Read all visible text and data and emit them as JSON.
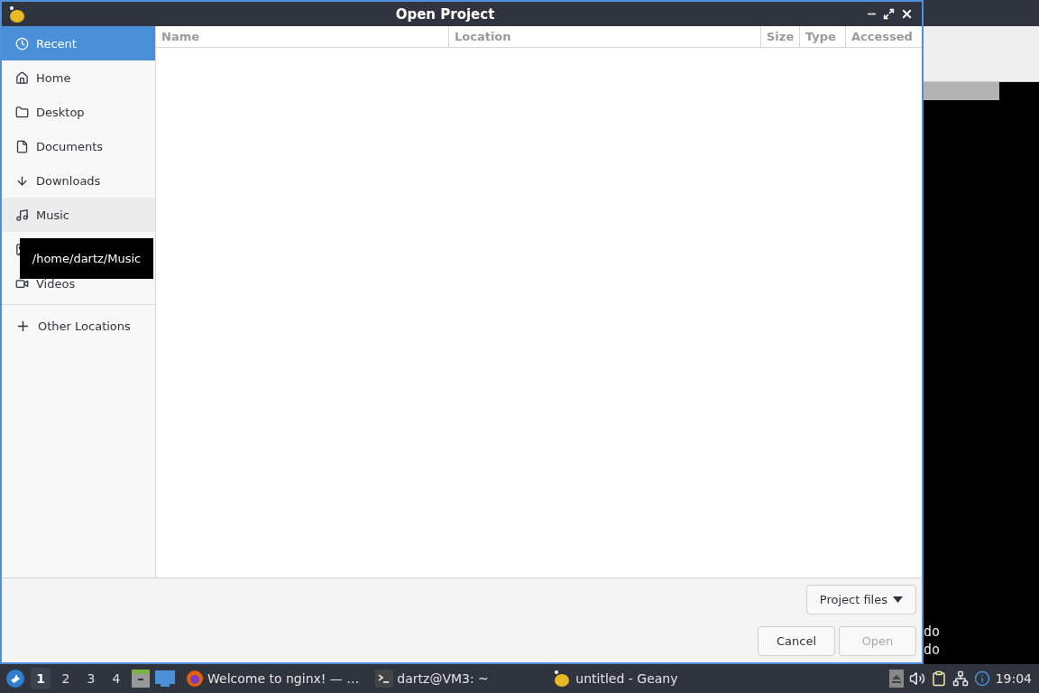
{
  "background_window": {
    "terminal_lines": [
      "do",
      "do"
    ]
  },
  "dialog": {
    "title": "Open Project",
    "sidebar": {
      "items": [
        {
          "label": "Recent",
          "selected": true,
          "hovered": false
        },
        {
          "label": "Home",
          "selected": false,
          "hovered": false
        },
        {
          "label": "Desktop",
          "selected": false,
          "hovered": false
        },
        {
          "label": "Documents",
          "selected": false,
          "hovered": false
        },
        {
          "label": "Downloads",
          "selected": false,
          "hovered": false
        },
        {
          "label": "Music",
          "selected": false,
          "hovered": true
        },
        {
          "selected": false,
          "hovered": false
        },
        {
          "label": "Videos",
          "selected": false,
          "hovered": false
        }
      ],
      "other_locations": "Other Locations"
    },
    "tooltip": "/home/dartz/Music",
    "table": {
      "columns": [
        "Name",
        "Location",
        "Size",
        "Type",
        "Accessed"
      ]
    },
    "filter": "Project files",
    "buttons": [
      {
        "label": "Cancel",
        "disabled": false
      },
      {
        "label": "Open",
        "disabled": true
      }
    ]
  },
  "taskbar": {
    "workspaces": [
      {
        "label": "1",
        "selected": true
      },
      {
        "label": "2",
        "selected": false
      },
      {
        "label": "3",
        "selected": false
      },
      {
        "label": "4",
        "selected": false
      }
    ],
    "tasks": [
      {
        "label": "Welcome to nginx! — …",
        "kind": "browser"
      },
      {
        "label": "dartz@VM3: ~",
        "kind": "terminal"
      },
      {
        "label": "untitled - Geany",
        "kind": "editor"
      }
    ],
    "clock": "19:04"
  }
}
